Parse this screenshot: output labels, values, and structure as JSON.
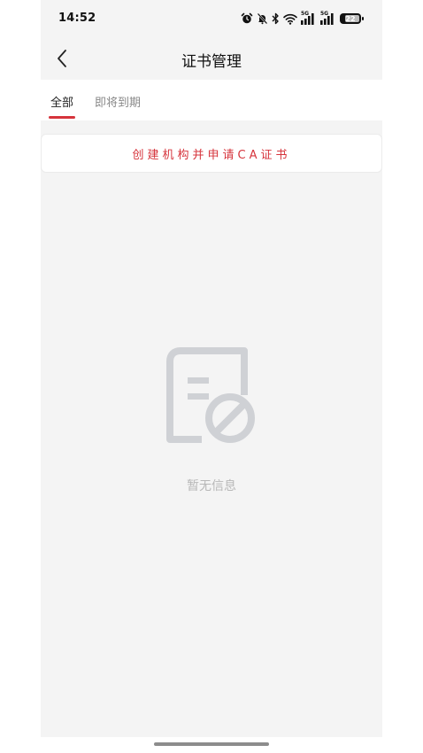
{
  "status_bar": {
    "time": "14:52",
    "signal1_label": "5G",
    "signal2_label": "5G",
    "battery_level": "22",
    "icons": [
      "alarm-icon",
      "bell-off-icon",
      "bluetooth-icon",
      "wifi-icon",
      "signal-icon",
      "signal-icon",
      "battery-icon"
    ]
  },
  "navbar": {
    "title": "证书管理",
    "back_icon": "chevron-left-icon"
  },
  "tabs": [
    {
      "label": "全部",
      "active": true
    },
    {
      "label": "即将到期",
      "active": false
    }
  ],
  "ca_card": {
    "label": "创建机构并申请CA证书"
  },
  "empty_state": {
    "icon": "no-document-icon",
    "message": "暂无信息"
  },
  "colors": {
    "accent": "#d6343c",
    "background": "#f4f4f4",
    "empty_icon": "#cfd1d5"
  }
}
